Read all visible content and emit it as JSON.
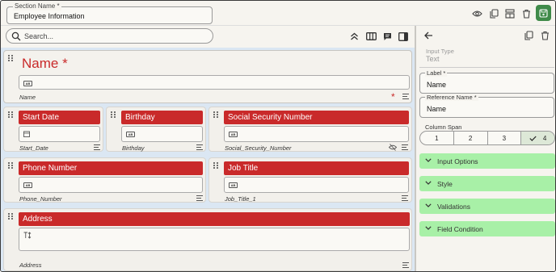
{
  "section": {
    "label": "Section Name *",
    "value": "Employee Information"
  },
  "toolbar_icons": [
    "eye-icon",
    "copy-icon",
    "layout-icon",
    "trash-icon",
    "save-icon"
  ],
  "search": {
    "placeholder": "Search..."
  },
  "canvas_toolbar_icons": [
    "collapse-up-icon",
    "columns-icon",
    "comment-icon",
    "panel-right-icon"
  ],
  "fields": {
    "name": {
      "label": "Name *",
      "ref": "Name",
      "required_marker": "*"
    },
    "start_date": {
      "label": "Start Date",
      "ref": "Start_Date"
    },
    "birthday": {
      "label": "Birthday",
      "ref": "Birthday"
    },
    "ssn": {
      "label": "Social Security Number",
      "ref": "Social_Security_Number"
    },
    "phone": {
      "label": "Phone Number",
      "ref": "Phone_Number"
    },
    "job_title": {
      "label": "Job Title",
      "ref": "Job_Title_1"
    },
    "address": {
      "label": "Address",
      "ref": "Address"
    }
  },
  "input_badge": "AB",
  "panel": {
    "input_type": {
      "label": "Input Type",
      "value": "Text"
    },
    "label_field": {
      "label": "Label *",
      "value": "Name"
    },
    "reference_field": {
      "label": "Reference Name *",
      "value": "Name"
    },
    "column_span": {
      "label": "Column Span",
      "options": [
        "1",
        "2",
        "3",
        "4"
      ],
      "selected": "4"
    },
    "sections": [
      "Input Options",
      "Style",
      "Validations",
      "Field Condition"
    ]
  },
  "colors": {
    "accent_red": "#c92a2a",
    "accordion_green": "#a8f0a7",
    "save_green": "#3f8a49",
    "canvas_blue": "#dbe7f3"
  }
}
